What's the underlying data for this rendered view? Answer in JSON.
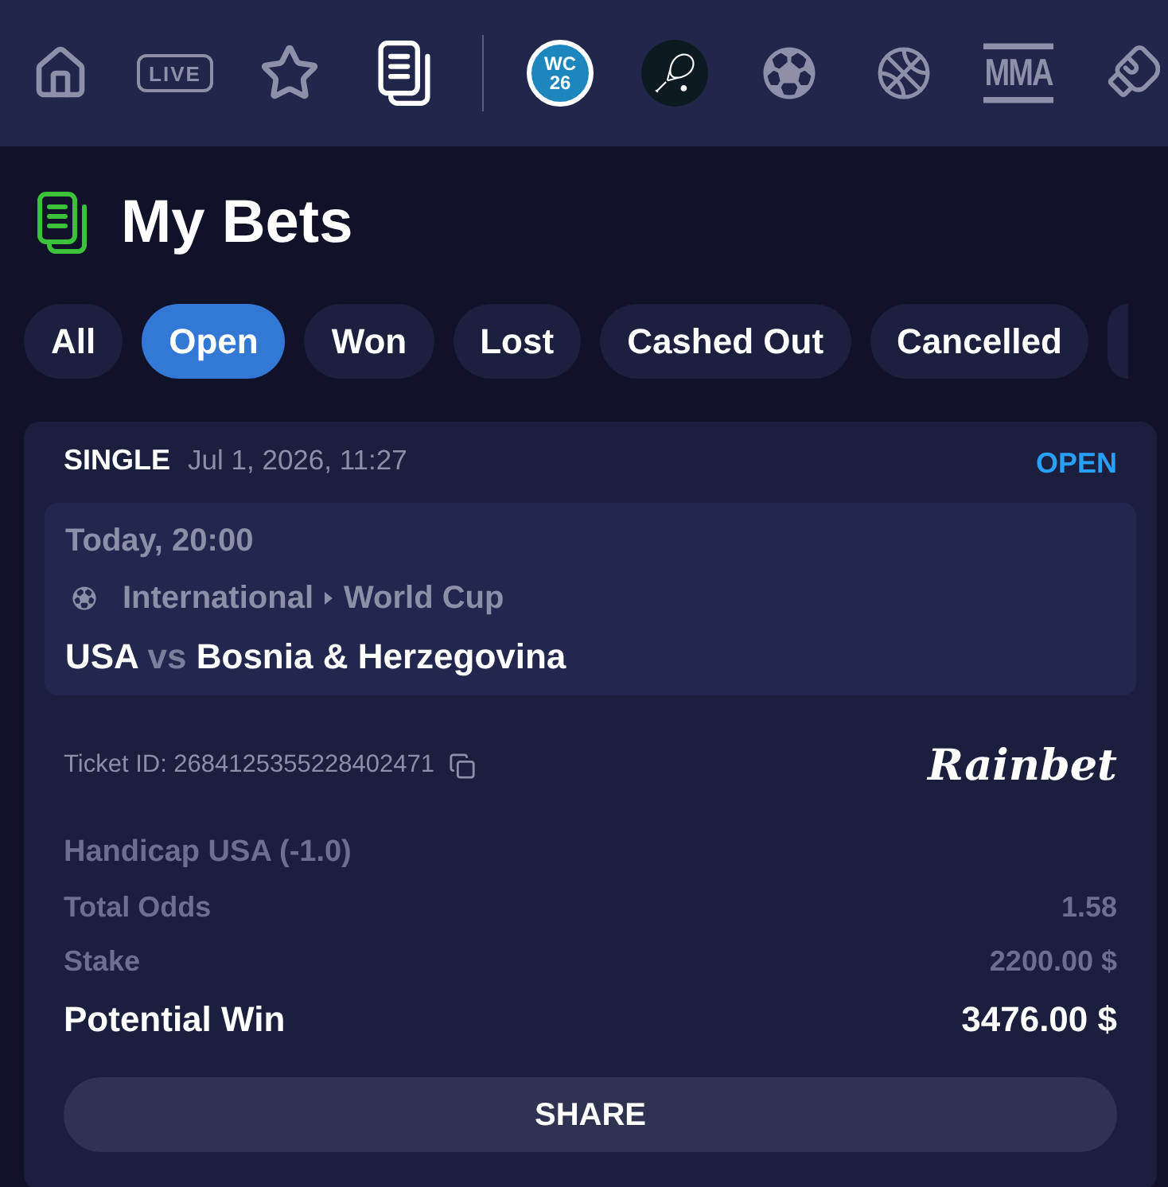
{
  "nav": {
    "items": [
      {
        "kind": "home",
        "selected": false
      },
      {
        "kind": "live",
        "label": "LIVE",
        "selected": false
      },
      {
        "kind": "star",
        "selected": false
      },
      {
        "kind": "bets",
        "selected": true
      }
    ],
    "sports": [
      {
        "kind": "wc26",
        "lines": [
          "WC",
          "26"
        ],
        "selected": false
      },
      {
        "kind": "tennis",
        "selected": false
      },
      {
        "kind": "soccer",
        "selected": false
      },
      {
        "kind": "basketball",
        "selected": false
      },
      {
        "kind": "mma",
        "label": "MMA",
        "selected": false
      },
      {
        "kind": "boxing",
        "selected": false
      }
    ]
  },
  "page": {
    "title": "My Bets"
  },
  "filters": [
    {
      "label": "All",
      "selected": false
    },
    {
      "label": "Open",
      "selected": true
    },
    {
      "label": "Won",
      "selected": false
    },
    {
      "label": "Lost",
      "selected": false
    },
    {
      "label": "Cashed Out",
      "selected": false
    },
    {
      "label": "Cancelled",
      "selected": false
    }
  ],
  "bet": {
    "type": "SINGLE",
    "placed": "Jul 1, 2026, 11:27",
    "status": "OPEN",
    "event": {
      "time": "Today, 20:00",
      "category": "International",
      "league": "World Cup",
      "home": "USA",
      "vs": "vs",
      "away": "Bosnia & Herzegovina"
    },
    "ticket": "Ticket ID: 2684125355228402471",
    "brand": "Rainbet",
    "selection": "Handicap USA (-1.0)",
    "rows": [
      {
        "kind": "normal",
        "label": "Total Odds",
        "value": "1.58"
      },
      {
        "kind": "normal",
        "label": "Stake",
        "value": "2200.00 $"
      },
      {
        "kind": "highlight",
        "label": "Potential Win",
        "value": "3476.00 $"
      }
    ],
    "share": "SHARE"
  }
}
